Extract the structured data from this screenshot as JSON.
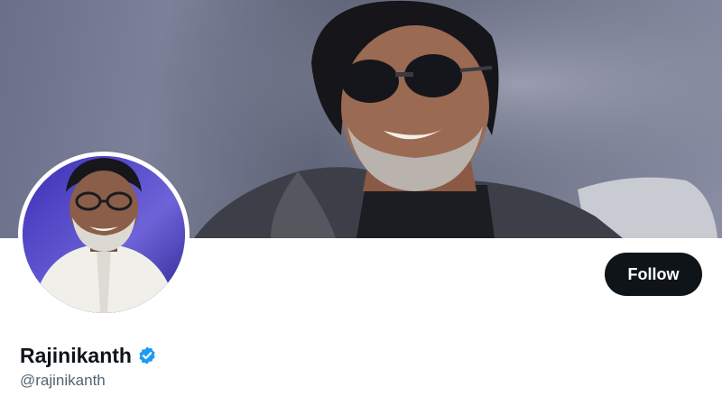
{
  "profile": {
    "display_name": "Rajinikanth",
    "handle": "@rajinikanth",
    "verified": true,
    "follow_label": "Follow"
  },
  "icons": {
    "verified": "verified-badge-icon"
  },
  "colors": {
    "follow_button_bg": "#0f1419",
    "follow_button_text": "#ffffff",
    "name_text": "#0f1419",
    "handle_text": "#536471",
    "verified_badge": "#1d9bf0"
  }
}
